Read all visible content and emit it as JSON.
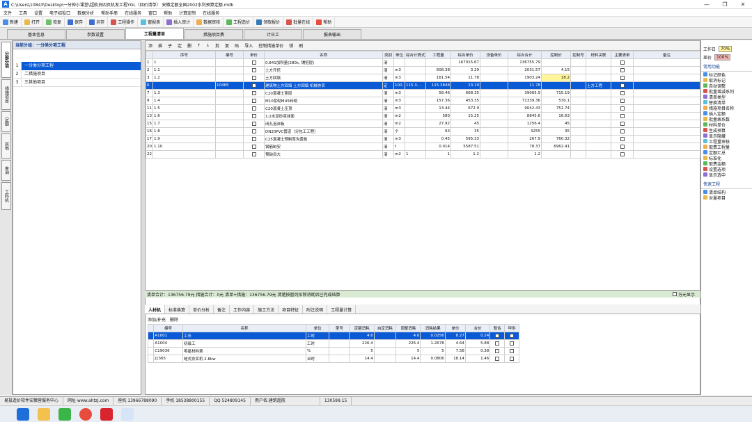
{
  "window": {
    "title": "C:\\Users\\10843\\Desktop\\一分钟小课堂\\超航员四页机发工程YGL（四价清单） 安徽定额全国2002水利预算定额.mdb",
    "controls": [
      "—",
      "❐",
      "✕"
    ]
  },
  "menu": [
    "文件",
    "工具",
    "设置",
    "电子招投口",
    "数据分析",
    "帮助手册",
    "在线服务",
    "窗口",
    "帮助",
    "计算定制",
    "在线服务"
  ],
  "toolbar": [
    "新建",
    "打开",
    "恢复",
    "保存",
    "另存",
    "工程操作",
    "窗报表",
    "插入审计",
    "数据审核",
    "工程造价",
    "领取报价",
    "批量在线",
    "帮助"
  ],
  "tabs": [
    "基本信息",
    "参数设置",
    "工程量清单",
    "措施项目费",
    "计日工",
    "报表输出"
  ],
  "active_tab": 2,
  "left_tabs": [
    "分部分项",
    "措施项目",
    "定额",
    "其他",
    "查询",
    "工料机"
  ],
  "tree": {
    "header": "当前分组：一分类分项工程",
    "items": [
      {
        "no": "1",
        "label": "一分类分项工程",
        "selected": true
      },
      {
        "no": "2",
        "label": "二措施项目",
        "selected": false
      },
      {
        "no": "3",
        "label": "三其他项目",
        "selected": false
      }
    ]
  },
  "gridbar": [
    "添",
    "插",
    "子",
    "定",
    "删",
    "剪",
    "复",
    "贴",
    "导入",
    "控制措施单价",
    "锁",
    "刷"
  ],
  "grid": {
    "headers": [
      "",
      "序号",
      "编号",
      "单价",
      "名称",
      "类别",
      "单位",
      "综合计算式",
      "工程量",
      "综合单价",
      "设备单价",
      "综合合计",
      "控制价",
      "控制号",
      "材料关联",
      "主要清单",
      "备注"
    ],
    "rows": [
      {
        "id": "1",
        "seq": "1",
        "code": "",
        "name": "0.841加积量(280k, 铺挖层)",
        "cat": "清",
        "unit": "",
        "formula": "",
        "qty": "",
        "price": "167015.67",
        "equip": "",
        "total": "136755.79",
        "ctrl": "",
        "sel": false
      },
      {
        "id": "2",
        "seq": "1.1",
        "code": "",
        "name": "土方开挖",
        "cat": "清",
        "unit": "m3",
        "formula": "",
        "qty": "608.38",
        "price": "3.29",
        "equip": "",
        "total": "2031.57",
        "ctrl": "4.15",
        "sel": false
      },
      {
        "id": "3",
        "seq": "1.2",
        "code": "",
        "name": "土方回填",
        "cat": "清",
        "unit": "m3",
        "formula": "",
        "qty": "161.54",
        "price": "11.78",
        "equip": "",
        "total": "1903.24",
        "ctrl": "18.2",
        "sel": false
      },
      {
        "id": "6",
        "seq": "",
        "code": "10465",
        "name": "建筑物土方回填 土方回填 机械夯实",
        "cat": "定",
        "unit": "100…",
        "formula": "115.3…",
        "qty": "115.3848",
        "price": "13.19",
        "equip": "",
        "total": "11.78",
        "ctrl": "",
        "rel": "土方工程",
        "sel": true
      },
      {
        "id": "7",
        "seq": "1.3",
        "code": "",
        "name": "C20混凝土垫层",
        "cat": "清",
        "unit": "m3",
        "formula": "",
        "qty": "58.46",
        "price": "668.35",
        "equip": "",
        "total": "39065.9",
        "ctrl": "715.19",
        "sel": false
      },
      {
        "id": "9",
        "seq": "1.4",
        "code": "",
        "name": "M10浆砌MU5砖砌",
        "cat": "清",
        "unit": "m3",
        "formula": "",
        "qty": "157.36",
        "price": "453.35",
        "equip": "",
        "total": "71339.36",
        "ctrl": "530.1",
        "sel": false
      },
      {
        "id": "11",
        "seq": "1.5",
        "code": "",
        "name": "C20混凝土压顶",
        "cat": "清",
        "unit": "m3",
        "formula": "",
        "qty": "13.44",
        "price": "672.9",
        "equip": "",
        "total": "9042.43",
        "ctrl": "751.74",
        "sel": false
      },
      {
        "id": "13",
        "seq": "1.6",
        "code": "",
        "name": "1:2水泥砂浆抹面",
        "cat": "清",
        "unit": "m2",
        "formula": "",
        "qty": "580",
        "price": "15.25",
        "equip": "",
        "total": "8845.6",
        "ctrl": "16.63",
        "sel": false
      },
      {
        "id": "15",
        "seq": "1.7",
        "code": "",
        "name": "闭孔泡沫板",
        "cat": "清",
        "unit": "m2",
        "formula": "",
        "qty": "27.92",
        "price": "45",
        "equip": "",
        "total": "1256.4",
        "ctrl": "45",
        "sel": false
      },
      {
        "id": "16",
        "seq": "1.8",
        "code": "",
        "name": "DN20PVC管道（分包工工程）",
        "cat": "清",
        "unit": "个",
        "formula": "",
        "qty": "93",
        "price": "35",
        "equip": "",
        "total": "3255",
        "ctrl": "35",
        "sel": false
      },
      {
        "id": "17",
        "seq": "1.9",
        "code": "",
        "name": "C25混凝土预制厚沟盖板",
        "cat": "清",
        "unit": "m3",
        "formula": "",
        "qty": "0.45",
        "price": "595.33",
        "equip": "",
        "total": "267.9",
        "ctrl": "760.32",
        "sel": false
      },
      {
        "id": "20",
        "seq": "1.10",
        "code": "",
        "name": "钢筋制安",
        "cat": "清",
        "unit": "t",
        "formula": "",
        "qty": "0.014",
        "price": "5587.51",
        "equip": "",
        "total": "78.37",
        "ctrl": "6962.41",
        "sel": false
      },
      {
        "id": "22",
        "seq": "",
        "code": "",
        "name": "预缺目大",
        "cat": "清",
        "unit": "m2",
        "formula": "1",
        "qty": "1",
        "price": "1.2",
        "equip": "",
        "total": "1.2",
        "ctrl": "",
        "sel": false
      }
    ]
  },
  "status1": "清单合计：136756.79元  措施合计：0元  清单+措施：136756.79元   清楚按暂列扣除消耗后已完成结算",
  "status1_check": "万元显示",
  "bottom_tabs": [
    "人材机",
    "标准换算",
    "单价分析",
    "备注",
    "工作内容",
    "施工方法",
    "项目特征",
    "附注说明",
    "工程量计算"
  ],
  "bottom_sub": [
    "添加/补充",
    "删除"
  ],
  "bottom_grid": {
    "headers": [
      "",
      "编号",
      "名称",
      "单位",
      "型号",
      "定额消耗",
      "自定消耗",
      "调整消耗",
      "消耗结果",
      "单价",
      "合价",
      "暂估",
      "甲供"
    ],
    "rows": [
      {
        "code": "A1001",
        "name": "工长",
        "unit": "工时",
        "model": "",
        "base": "4.6",
        "self": "",
        "adj": "4.6",
        "res": "0.0256",
        "price": "8.27",
        "total": "0.24",
        "sel": true
      },
      {
        "code": "A1004",
        "name": "初级工",
        "unit": "工时",
        "model": "",
        "base": "226.4",
        "self": "",
        "adj": "226.4",
        "res": "1.2678",
        "price": "4.64",
        "total": "5.88",
        "sel": false
      },
      {
        "code": "C19036",
        "name": "零星材料费",
        "unit": "%",
        "model": "",
        "base": "5",
        "self": "",
        "adj": "5",
        "res": "5",
        "price": "7.58",
        "total": "0.38",
        "sel": false
      },
      {
        "code": "J1365",
        "name": "蛙式夯实机 2.8kw",
        "unit": "台时",
        "model": "",
        "base": "14.4",
        "self": "",
        "adj": "14.4",
        "res": "0.0806",
        "price": "18.14",
        "total": "1.46",
        "sel": false
      }
    ]
  },
  "right": {
    "rate1_label": "工作日",
    "rate1": "70%",
    "rate2_label": "差价",
    "rate2": "100%",
    "sec1": "常用功能",
    "items1": [
      "标记颜色",
      "取消标记",
      "自动调整",
      "批量增减系列",
      "清单类型",
      "替换清单",
      "措施项目名称",
      "插入定额",
      "批量乘系数",
      "材料单价",
      "生成预算",
      "显示隐藏",
      "工程量审核",
      "取费工程量",
      "定额汇总",
      "标准化",
      "取费金额",
      "设置选项",
      "显示选中"
    ],
    "sec2": "快速工程",
    "items2": [
      "清单结构",
      "对量项目"
    ]
  },
  "statusbar": [
    "易投造价软件安徽营服务中心",
    "网址 www.ahtzj.com",
    "座机 13966788090",
    "手机 18538800155",
    "QQ 524809145",
    "用户名:建筑超航",
    "130599.15"
  ],
  "colors": {
    "accent": "#0a5ad6",
    "yellow": "#fff59a",
    "status": "#d9ead3"
  }
}
